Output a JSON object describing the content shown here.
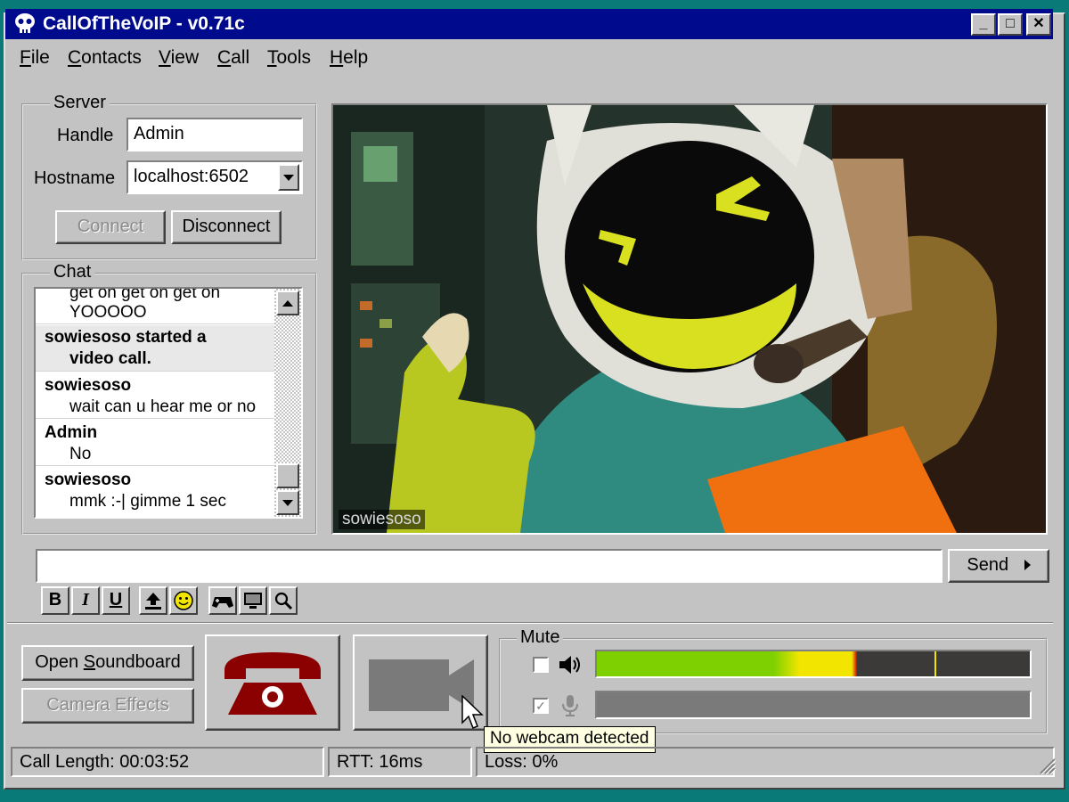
{
  "window": {
    "title": "CallOfTheVoIP - v0.71c",
    "controls": {
      "minimize": "_",
      "maximize": "□",
      "close": "✕"
    }
  },
  "menu": {
    "items": [
      {
        "accel": "F",
        "rest": "ile"
      },
      {
        "accel": "C",
        "rest": "ontacts"
      },
      {
        "accel": "V",
        "rest": "iew"
      },
      {
        "accel": "C",
        "rest": "all"
      },
      {
        "accel": "T",
        "rest": "ools"
      },
      {
        "accel": "H",
        "rest": "elp"
      }
    ]
  },
  "server": {
    "legend": "Server",
    "handle_label": "Handle",
    "handle_value": "Admin",
    "hostname_label": "Hostname",
    "hostname_value": "localhost:6502",
    "connect_label": "Connect",
    "disconnect_label": "Disconnect"
  },
  "chat": {
    "legend": "Chat",
    "messages": [
      {
        "sender": "",
        "text": "get on get on get on"
      },
      {
        "sender": "",
        "text": "YOOOOO"
      },
      {
        "sender": "sowiesoso started a",
        "text": "video call."
      },
      {
        "sender": "sowiesoso",
        "text": "wait can u hear me or no"
      },
      {
        "sender": "Admin",
        "text": "No"
      },
      {
        "sender": "sowiesoso",
        "text": "mmk :-| gimme 1 sec"
      }
    ]
  },
  "video": {
    "caption": "sowiesoso"
  },
  "compose": {
    "value": "",
    "send_label": "Send",
    "toolbar": [
      {
        "name": "bold",
        "glyph": "B"
      },
      {
        "name": "italic",
        "glyph": "I"
      },
      {
        "name": "underline",
        "glyph": "U"
      }
    ]
  },
  "controls": {
    "soundboard_accel": "S",
    "soundboard_pre": "Open ",
    "soundboard_post": "oundboard",
    "camera_effects_label": "Camera Effects",
    "mute_legend": "Mute",
    "speaker_muted": false,
    "mic_muted": true,
    "output_level": 0.6,
    "peak_level": 0.78,
    "input_level": 0.0,
    "webcam_tooltip": "No webcam detected"
  },
  "status": {
    "call_length": "Call Length: 00:03:52",
    "rtt": "RTT: 16ms",
    "loss": "Loss: 0%"
  },
  "colors": {
    "titlebar": "#000a8c",
    "hangup": "#8b0000",
    "meter_green": "#7ed000",
    "meter_yellow": "#f2e600",
    "meter_red": "#d00000"
  }
}
